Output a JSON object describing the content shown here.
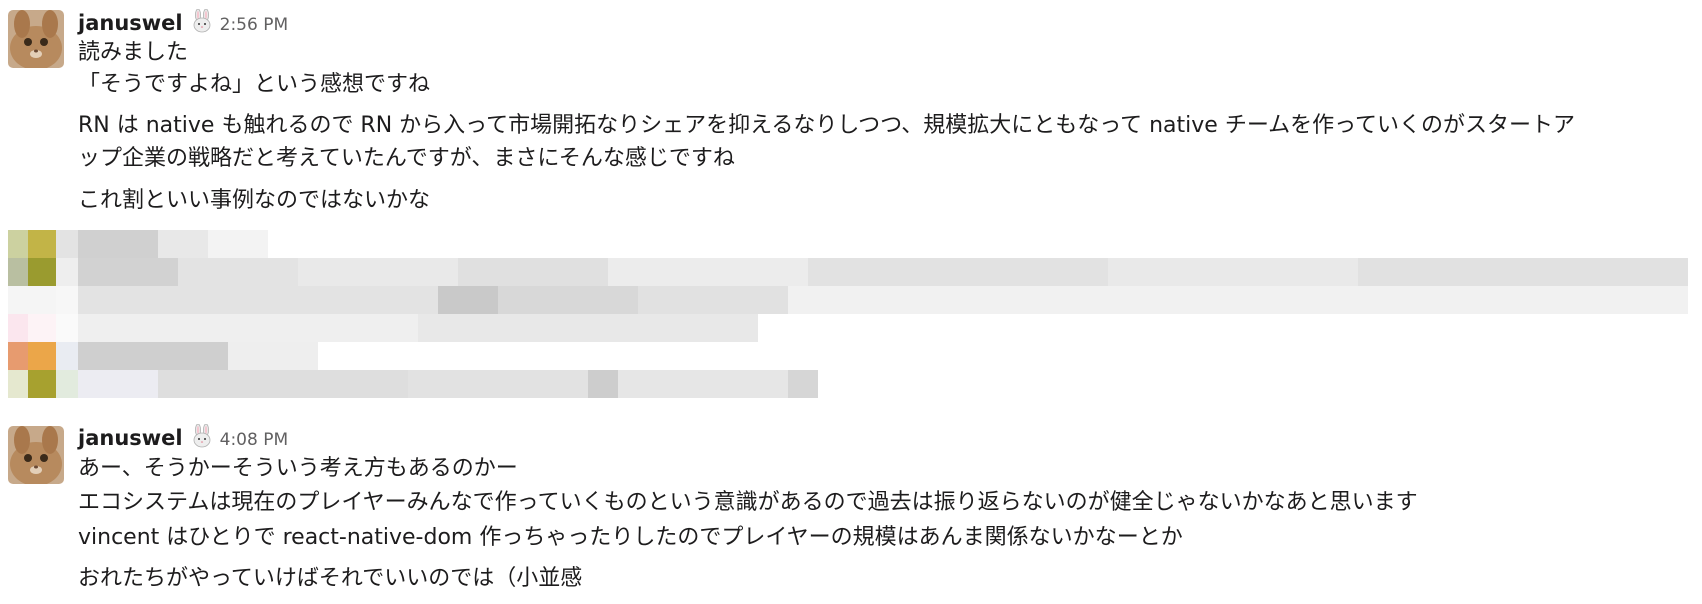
{
  "messages": [
    {
      "user": "januswel",
      "status_emoji": "rabbit-face-icon",
      "time": "2:56 PM",
      "lines": [
        "読みました",
        "「そうですよね」という感想ですね",
        "RN は native も触れるので RN から入って市場開拓なりシェアを抑えるなりしつつ、規模拡大にともなって native チームを作っていくのがスタートア",
        "ップ企業の戦略だと考えていたんですが、まさにそんな感じですね",
        "これ割といい事例なのではないかな"
      ]
    },
    {
      "user": "januswel",
      "status_emoji": "rabbit-face-icon",
      "time": "4:08 PM",
      "lines": [
        "あー、そうかーそういう考え方もあるのかー",
        "エコシステムは現在のプレイヤーみんなで作っていくものという意識があるので過去は振り返らないのが健全じゃないかなあと思います",
        "vincent はひとりで react-native-dom 作っちゃったりしたのでプレイヤーの規模はあんま関係ないかなーとか",
        "おれたちがやっていけばそれでいいのでは（小並感"
      ]
    }
  ],
  "colors": {
    "text": "#1d1c1d",
    "timestamp": "#616061",
    "background": "#ffffff"
  }
}
